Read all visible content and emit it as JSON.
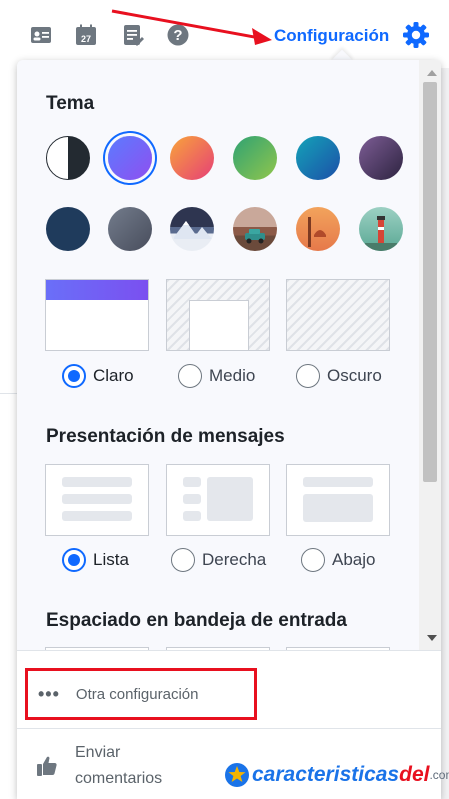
{
  "toolbar": {
    "icons": [
      "contact-card-icon",
      "calendar-icon",
      "notepad-icon",
      "help-icon"
    ],
    "calendar_day": "27",
    "settings_label": "Configuración",
    "gear_icon": "gear-icon",
    "accent": "#0f69ff",
    "annotation_arrow_color": "#e8101f"
  },
  "panel": {
    "theme": {
      "title": "Tema",
      "swatches": [
        {
          "name": "contrast",
          "selected": false
        },
        {
          "name": "violet",
          "selected": true
        },
        {
          "name": "orange-pink",
          "selected": false
        },
        {
          "name": "green",
          "selected": false
        },
        {
          "name": "teal-blue",
          "selected": false
        },
        {
          "name": "purple",
          "selected": false
        },
        {
          "name": "navy",
          "selected": false
        },
        {
          "name": "slate",
          "selected": false
        },
        {
          "name": "mountain-scene",
          "selected": false
        },
        {
          "name": "car-scene",
          "selected": false
        },
        {
          "name": "desert-scene",
          "selected": false
        },
        {
          "name": "lighthouse-scene",
          "selected": false
        }
      ],
      "modes": [
        {
          "label": "Claro",
          "selected": true
        },
        {
          "label": "Medio",
          "selected": false
        },
        {
          "label": "Oscuro",
          "selected": false
        }
      ]
    },
    "message_layout": {
      "title": "Presentación de mensajes",
      "options": [
        {
          "label": "Lista",
          "selected": true
        },
        {
          "label": "Derecha",
          "selected": false
        },
        {
          "label": "Abajo",
          "selected": false
        }
      ]
    },
    "inbox_spacing": {
      "title": "Espaciado en bandeja de entrada"
    },
    "footer": {
      "other_settings_label": "Otra configuración",
      "feedback_label_line1": "Enviar",
      "feedback_label_line2": "comentarios",
      "highlight_color": "#e8101f"
    }
  },
  "watermark": {
    "text": "caracteristicas",
    "suffix": "del",
    "domain": ".com"
  }
}
